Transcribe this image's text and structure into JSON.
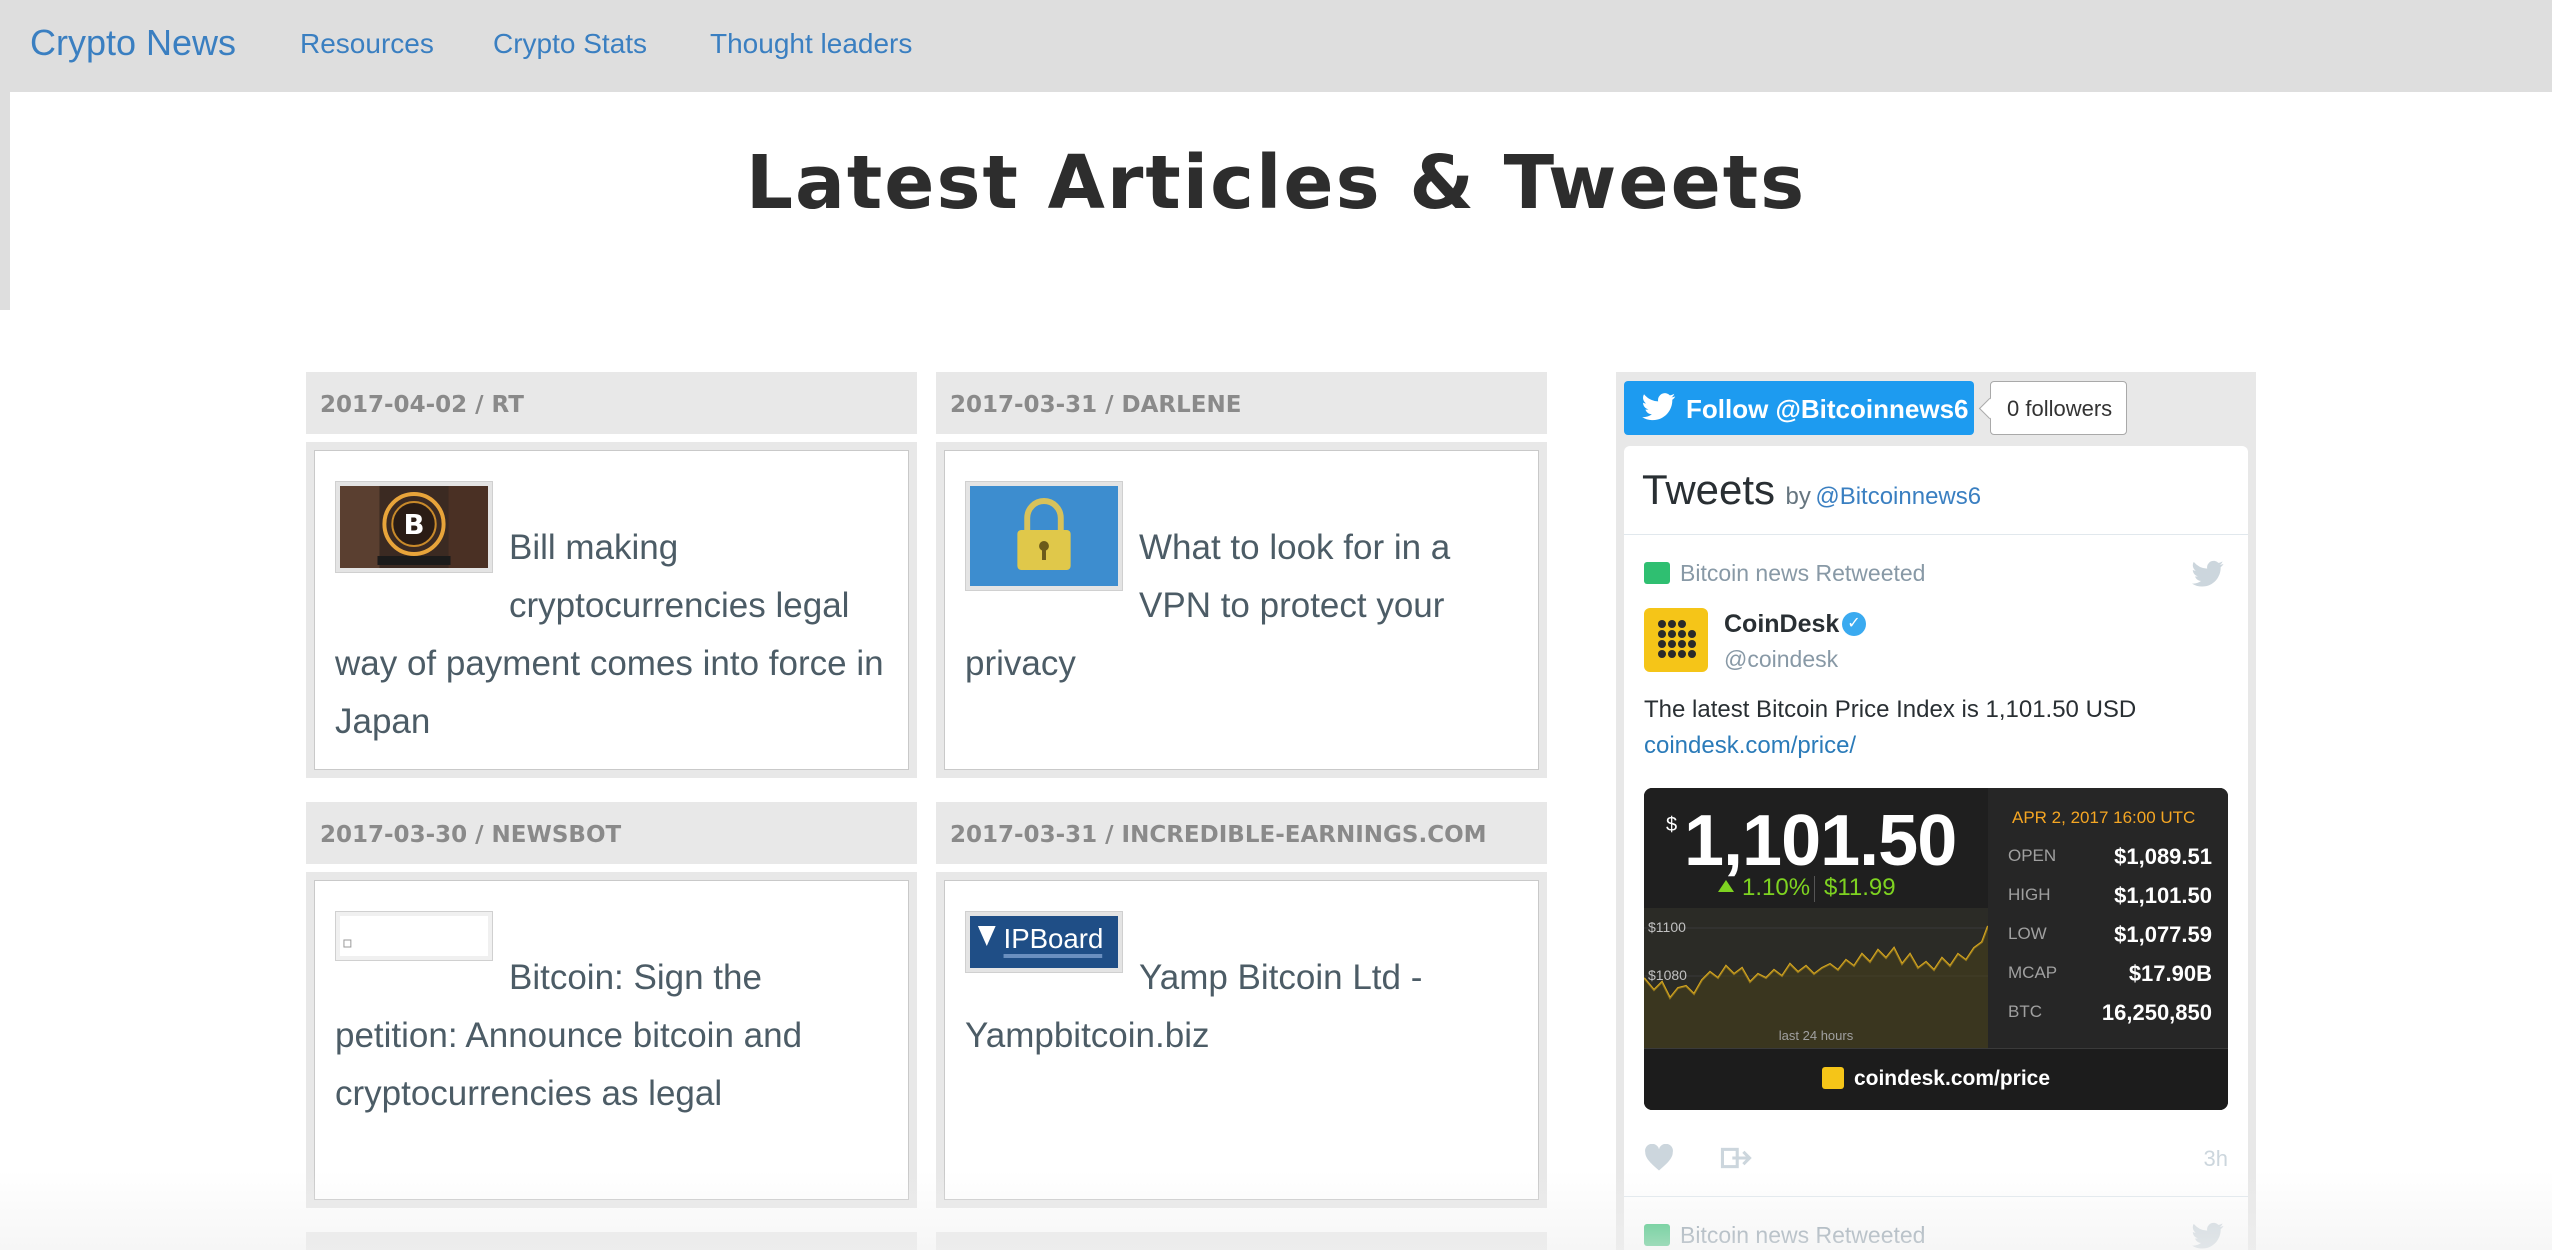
{
  "navbar": {
    "brand": "Crypto News",
    "links": [
      "Resources",
      "Crypto Stats",
      "Thought leaders"
    ]
  },
  "page_title": "Latest Articles & Tweets",
  "articles": [
    {
      "meta": "2017-04-02 / RT",
      "title": "Bill making cryptocurrencies legal way of payment comes into force in Japan",
      "thumb": "bitcoin-accepted-here"
    },
    {
      "meta": "2017-03-31 / DARLENE",
      "title": "What to look for in a VPN to protect your privacy",
      "thumb": "padlock"
    },
    {
      "meta": "2017-03-30 / NEWSBOT",
      "title": "Bitcoin: Sign the petition: Announce bitcoin and cryptocurrencies as legal",
      "thumb": "broken-image"
    },
    {
      "meta": "2017-03-31 / INCREDIBLE-EARNINGS.COM",
      "title": "Yamp Bitcoin Ltd - Yampbitcoin.biz",
      "thumb": "ipboard-logo"
    }
  ],
  "twitter": {
    "follow_button": "Follow @Bitcoinnews6",
    "followers": "0 followers",
    "title": "Tweets",
    "by": "by",
    "handle": "@Bitcoinnews6",
    "tweets": [
      {
        "retweet_label": "Bitcoin news Retweeted",
        "author": "CoinDesk",
        "author_handle": "@coindesk",
        "text": "The latest Bitcoin Price Index is 1,101.50 USD",
        "link": "coindesk.com/price/",
        "time": "3h"
      },
      {
        "retweet_label": "Bitcoin news Retweeted"
      }
    ],
    "coindesk_widget": {
      "currency_symbol": "$",
      "price": "1,101.50",
      "change_pct": "1.10%",
      "change_abs": "$11.99",
      "date": "APR 2, 2017 16:00 UTC",
      "stats": [
        {
          "k": "OPEN",
          "v": "$1,089.51"
        },
        {
          "k": "HIGH",
          "v": "$1,101.50"
        },
        {
          "k": "LOW",
          "v": "$1,077.59"
        },
        {
          "k": "MCAP",
          "v": "$17.90B"
        },
        {
          "k": "BTC",
          "v": "16,250,850"
        }
      ],
      "y_labels": [
        "$1100",
        "$1080"
      ],
      "range_label": "last 24 hours",
      "footer": "coindesk.com/price"
    }
  },
  "colors": {
    "link": "#3a7fc1",
    "twitter": "#1d9bf0",
    "retweet": "#2fbf71",
    "coindesk_gold": "#f5c518",
    "gain": "#7ed321"
  }
}
